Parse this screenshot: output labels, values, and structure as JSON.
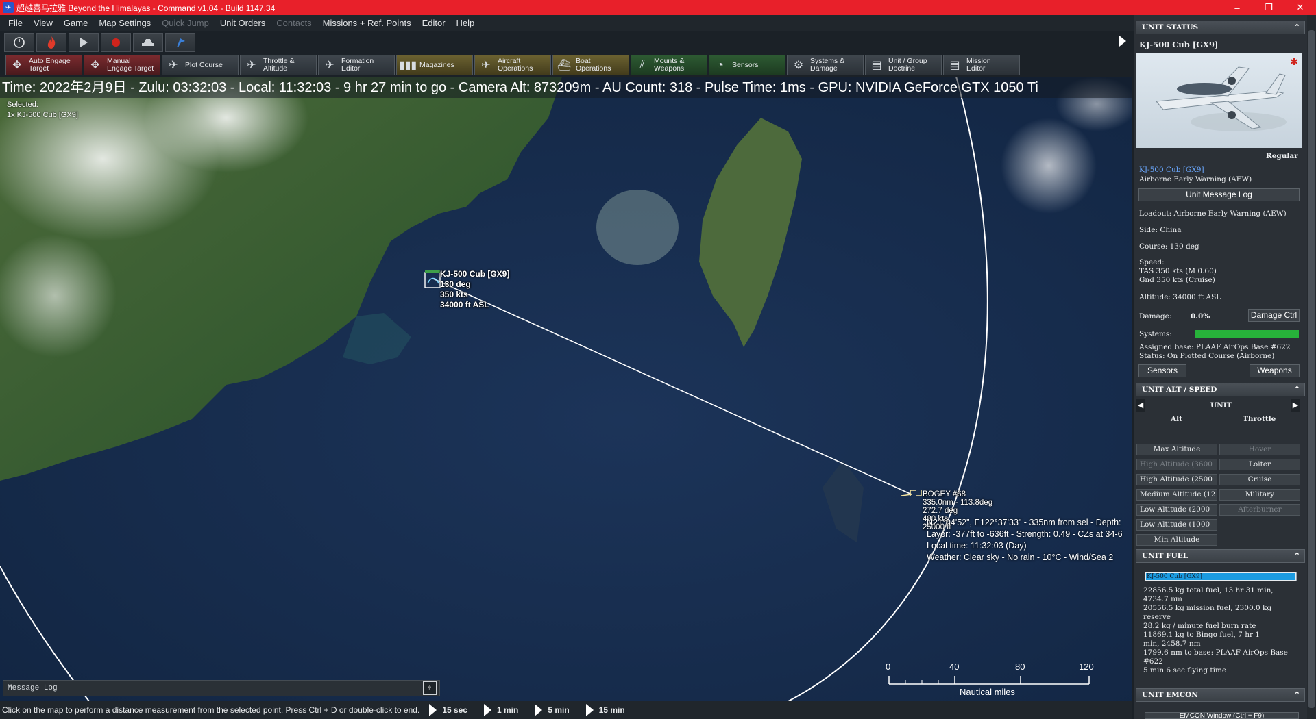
{
  "window": {
    "title": "超越喜马拉雅 Beyond the Himalayas - Command v1.04 - Build 1147.34",
    "minimize": "–",
    "restore": "❐",
    "close": "✕"
  },
  "menu": [
    {
      "label": "File",
      "enabled": true
    },
    {
      "label": "View",
      "enabled": true
    },
    {
      "label": "Game",
      "enabled": true
    },
    {
      "label": "Map Settings",
      "enabled": true
    },
    {
      "label": "Quick Jump",
      "enabled": false
    },
    {
      "label": "Unit Orders",
      "enabled": true
    },
    {
      "label": "Contacts",
      "enabled": false
    },
    {
      "label": "Missions + Ref. Points",
      "enabled": true
    },
    {
      "label": "Editor",
      "enabled": true
    },
    {
      "label": "Help",
      "enabled": true
    }
  ],
  "playbar": [
    {
      "name": "clock-icon"
    },
    {
      "name": "fire-icon"
    },
    {
      "name": "play-icon"
    },
    {
      "name": "record-icon"
    },
    {
      "name": "plane-icon"
    },
    {
      "name": "flag-icon"
    }
  ],
  "toolbar": [
    {
      "label": "Auto Engage\nTarget",
      "icon": "✥",
      "tone": "red",
      "name": "auto-engage-target-button"
    },
    {
      "label": "Manual\nEngage Target",
      "icon": "✥",
      "tone": "red",
      "name": "manual-engage-target-button"
    },
    {
      "label": "Plot Course",
      "icon": "✈",
      "tone": "",
      "name": "plot-course-button"
    },
    {
      "label": "Throttle &\nAltitude",
      "icon": "✈",
      "tone": "",
      "name": "throttle-altitude-button"
    },
    {
      "label": "Formation\nEditor",
      "icon": "✈",
      "tone": "",
      "name": "formation-editor-button"
    },
    {
      "label": "Magazines",
      "icon": "▮▮▮",
      "tone": "yel",
      "name": "magazines-button"
    },
    {
      "label": "Aircraft\nOperations",
      "icon": "✈",
      "tone": "yel",
      "name": "aircraft-operations-button"
    },
    {
      "label": "Boat\nOperations",
      "icon": "⛴",
      "tone": "yel",
      "name": "boat-operations-button"
    },
    {
      "label": "Mounts &\nWeapons",
      "icon": "⫽",
      "tone": "grn",
      "name": "mounts-weapons-button"
    },
    {
      "label": "Sensors",
      "icon": "◔",
      "tone": "grn",
      "name": "sensors-button"
    },
    {
      "label": "Systems &\nDamage",
      "icon": "⚙",
      "tone": "",
      "name": "systems-damage-button"
    },
    {
      "label": "Unit / Group\nDoctrine",
      "icon": "▤",
      "tone": "",
      "name": "unit-group-doctrine-button"
    },
    {
      "label": "Mission\nEditor",
      "icon": "▤",
      "tone": "",
      "name": "mission-editor-button"
    }
  ],
  "status_line": "Time: 2022年2月9日 - Zulu: 03:32:03 - Local: 11:32:03 - 9 hr 27 min to go  - Camera Alt: 873209m  - AU Count: 318 - Pulse Time: 1ms - GPU: NVIDIA GeForce GTX 1050 Ti",
  "selected": {
    "heading": "Selected:",
    "item": "1x KJ-500 Cub [GX9]"
  },
  "unit_label": [
    "KJ-500 Cub [GX9]",
    "130 deg",
    "350 kts",
    "34000 ft ASL"
  ],
  "bogey_label": [
    "BOGEY #68",
    "335.0nm - 113.8deg",
    "272.7 deg",
    "480 kts",
    "25000 ft"
  ],
  "hover_info": [
    "N21°04'52\", E122°37'33\" - 335nm from sel - Depth:",
    "Layer: -377ft to -636ft - Strength: 0.49 - CZs at 34-6",
    "Local time: 11:32:03 (Day)",
    "Weather: Clear sky - No rain - 10°C - Wind/Sea 2"
  ],
  "scale": {
    "ticks": [
      "0",
      "40",
      "80",
      "120"
    ],
    "unit": "Nautical miles"
  },
  "message_log": {
    "label": "Message Log",
    "expand": "⇧"
  },
  "bottom": {
    "hint": "Click on the map to perform a distance measurement from the selected point. Press Ctrl + D or double-click to end.",
    "time_compression": [
      "15 sec",
      "1 min",
      "5 min",
      "15 min"
    ]
  },
  "panel": {
    "unit_status": {
      "header": "UNIT STATUS",
      "name": "KJ-500 Cub [GX9]",
      "proficiency": "Regular",
      "link": "KJ-500 Cub [GX9]",
      "role": "Airborne Early Warning (AEW)",
      "message_log_btn": "Unit Message Log",
      "loadout": "Loadout: Airborne Early Warning (AEW)",
      "side": "Side: China",
      "course": "Course: 130 deg",
      "speed_title": "Speed:",
      "speed_tas": "TAS 350 kts (M 0.60)",
      "speed_gnd": "Gnd 350 kts (Cruise)",
      "altitude": "Altitude: 34000 ft ASL",
      "damage_label": "Damage:",
      "damage_value": "0.0%",
      "damage_btn": "Damage Ctrl",
      "systems_label": "Systems:",
      "systems_fraction": 1.0,
      "assigned_base": "Assigned base: PLAAF AirOps Base #622",
      "status": "Status: On Plotted Course (Airborne)",
      "sensors_btn": "Sensors",
      "weapons_btn": "Weapons"
    },
    "alt_speed": {
      "header": "UNIT ALT / SPEED",
      "sub": "UNIT",
      "col_alt": "Alt",
      "col_throttle": "Throttle",
      "alt_options": [
        {
          "label": "Max Altitude",
          "enabled": true
        },
        {
          "label": "High Altitude (3600",
          "enabled": false
        },
        {
          "label": "High Altitude (2500",
          "enabled": true
        },
        {
          "label": "Medium Altitude (12",
          "enabled": true
        },
        {
          "label": "Low Altitude (2000",
          "enabled": true
        },
        {
          "label": "Low Altitude (1000",
          "enabled": true
        },
        {
          "label": "Min Altitude",
          "enabled": true
        }
      ],
      "throttle_options": [
        {
          "label": "Hover",
          "enabled": false
        },
        {
          "label": "Loiter",
          "enabled": true
        },
        {
          "label": "Cruise",
          "enabled": true
        },
        {
          "label": "Military",
          "enabled": true
        },
        {
          "label": "Afterburner",
          "enabled": false
        }
      ]
    },
    "fuel": {
      "header": "UNIT FUEL",
      "bar_label": "KJ-500 Cub [GX9]",
      "bar_fraction": 1.0,
      "lines": [
        "22856.5 kg total fuel, 13 hr 31 min,",
        "4734.7 nm",
        "20556.5 kg mission fuel, 2300.0 kg",
        "reserve",
        "28.2 kg / minute fuel burn rate",
        "11869.1 kg to Bingo fuel, 7 hr 1",
        "min, 2458.7 nm",
        "1799.6 nm to base: PLAAF AirOps Base",
        "#622",
        "5 min 6 sec flying time"
      ]
    },
    "emcon": {
      "header": "UNIT EMCON",
      "window_btn": "EMCON Window (Ctrl + F9)"
    }
  }
}
